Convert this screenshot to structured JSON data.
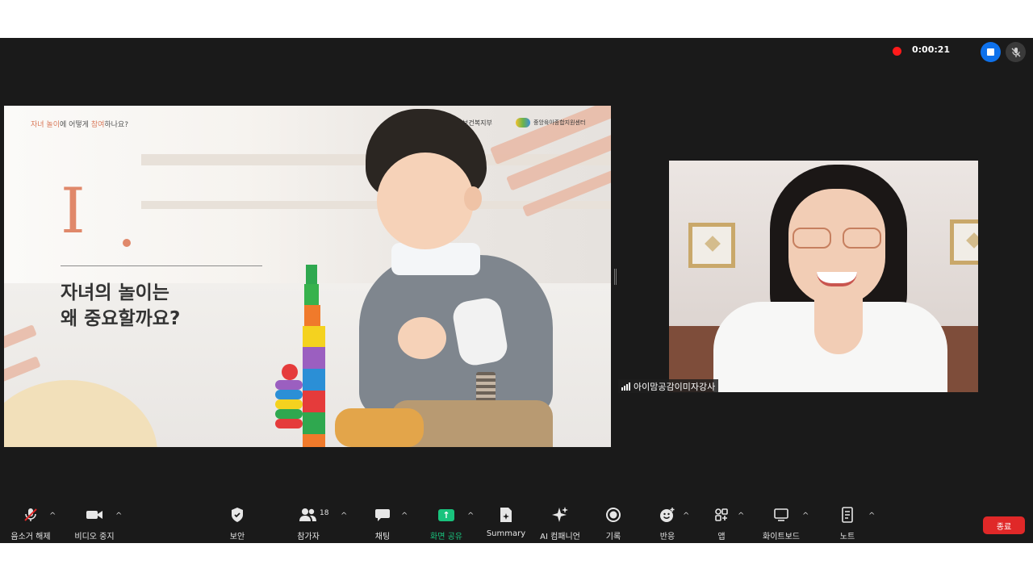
{
  "recording": {
    "time": "0:00:21"
  },
  "slide": {
    "topic_part1": "자녀 놀이",
    "topic_part2": "에  어떻게 ",
    "topic_part3": "참여",
    "topic_part4": "하나요?",
    "logo1": "보건복지부",
    "logo2": "중앙육아종합지원센터",
    "roman": "I",
    "headline_line1": "자녀의 놀이는",
    "headline_line2": "왜 중요할까요?"
  },
  "video_tile": {
    "participant_name": "아이맘공감이미자강사"
  },
  "toolbar": {
    "unmute": "음소거 해제",
    "stop_video": "비디오 중지",
    "security": "보안",
    "participants": "참가자",
    "participants_count": "18",
    "chat": "채팅",
    "share_screen": "화면 공유",
    "summary": "Summary",
    "ai_companion": "AI 컴패니언",
    "record": "기록",
    "reactions": "반응",
    "apps": "앱",
    "whiteboard": "화이트보드",
    "notes": "노트",
    "end": "종료"
  },
  "colors": {
    "accent": "#e0886a",
    "share_green": "#19c37d",
    "end_red": "#e02828",
    "record_red": "#ff1a1a",
    "stop_blue": "#0e71eb"
  }
}
